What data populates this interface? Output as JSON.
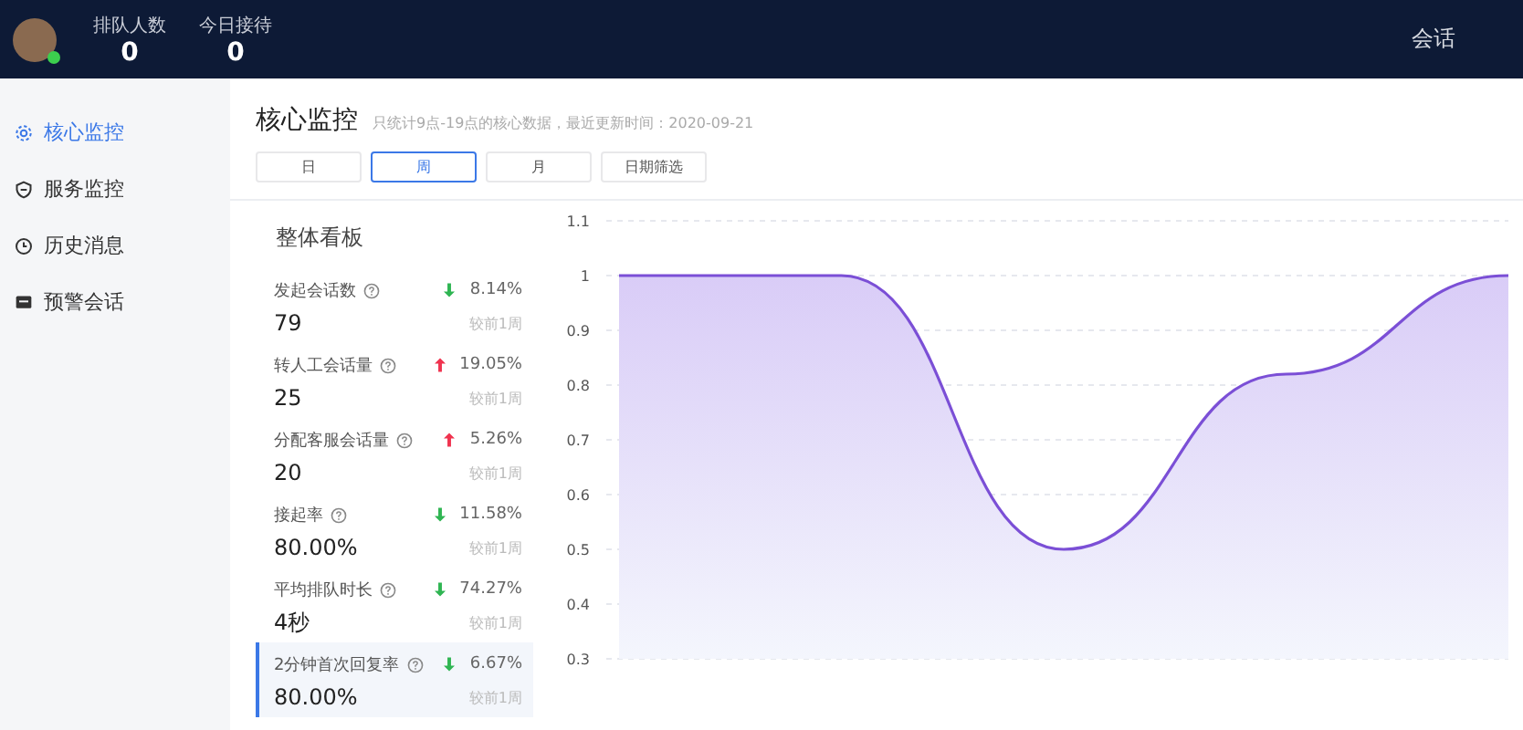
{
  "topbar": {
    "online": true,
    "stats": [
      {
        "label": "排队人数",
        "value": "0"
      },
      {
        "label": "今日接待",
        "value": "0"
      }
    ],
    "nav": "会话"
  },
  "sidebar": {
    "items": [
      {
        "label": "核心监控",
        "selected": true
      },
      {
        "label": "服务监控",
        "selected": false
      },
      {
        "label": "历史消息",
        "selected": false
      },
      {
        "label": "预警会话",
        "selected": false
      }
    ]
  },
  "header": {
    "title": "核心监控",
    "subtitle": "只统计9点-19点的核心数据，最近更新时间：2020-09-21",
    "tabs": [
      {
        "label": "日",
        "selected": false
      },
      {
        "label": "周",
        "selected": true
      },
      {
        "label": "月",
        "selected": false
      },
      {
        "label": "日期筛选",
        "selected": false
      }
    ]
  },
  "board": {
    "title": "整体看板",
    "metrics": [
      {
        "label": "发起会话数",
        "value": "79",
        "kind": "down",
        "change": "8.14%",
        "compare": "较前1周",
        "selected": false
      },
      {
        "label": "转人工会话量",
        "value": "25",
        "kind": "up",
        "change": "19.05%",
        "compare": "较前1周",
        "selected": false
      },
      {
        "label": "分配客服会话量",
        "value": "20",
        "kind": "up",
        "change": "5.26%",
        "compare": "较前1周",
        "selected": false
      },
      {
        "label": "接起率",
        "value": "80.00%",
        "kind": "down",
        "change": "11.58%",
        "compare": "较前1周",
        "selected": false
      },
      {
        "label": "平均排队时长",
        "value": "4秒",
        "kind": "down",
        "change": "74.27%",
        "compare": "较前1周",
        "selected": false
      },
      {
        "label": "2分钟首次回复率",
        "value": "80.00%",
        "kind": "down",
        "change": "6.67%",
        "compare": "较前1周",
        "selected": true
      }
    ],
    "chart_data": {
      "type": "area",
      "grid": true,
      "series": [
        {
          "color": "#7b4fd6",
          "values": [
            1,
            1,
            0.5,
            0.82,
            1
          ]
        }
      ],
      "ylim": [
        0.3,
        1.1
      ],
      "yticks": [
        0.3,
        0.4,
        0.5,
        0.6,
        0.7,
        0.8,
        0.9,
        1,
        1.1
      ]
    }
  }
}
